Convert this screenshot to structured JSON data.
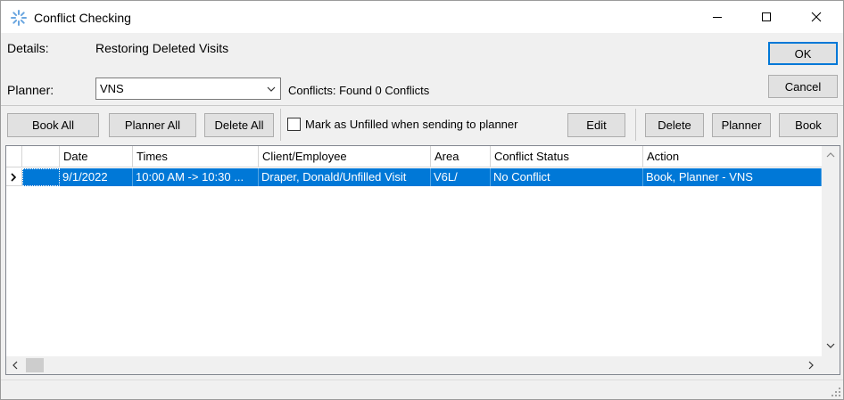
{
  "window": {
    "title": "Conflict Checking",
    "controls": {
      "minimize": "—",
      "maximize": "☐",
      "close": "✕"
    }
  },
  "details": {
    "label": "Details:",
    "value": "Restoring Deleted Visits"
  },
  "planner": {
    "label": "Planner:",
    "selected": "VNS"
  },
  "conflicts": {
    "text": "Conflicts: Found 0 Conflicts"
  },
  "buttons": {
    "ok": "OK",
    "cancel": "Cancel",
    "book_all": "Book All",
    "planner_all": "Planner All",
    "delete_all": "Delete All",
    "edit": "Edit",
    "delete": "Delete",
    "planner": "Planner",
    "book": "Book"
  },
  "mark_unfilled": {
    "label": "Mark as Unfilled when sending to planner",
    "checked": false
  },
  "grid": {
    "columns": [
      "Date",
      "Times",
      "Client/Employee",
      "Area",
      "Conflict Status",
      "Action"
    ],
    "rows": [
      {
        "indicator": "›",
        "cells": [
          "9/1/2022",
          "10:00 AM -> 10:30 ...",
          "Draper, Donald/Unfilled Visit",
          "V6L/",
          "No Conflict",
          "Book, Planner - VNS"
        ]
      }
    ]
  },
  "colors": {
    "selection": "#0078d7",
    "default_button_border": "#0078d7"
  }
}
